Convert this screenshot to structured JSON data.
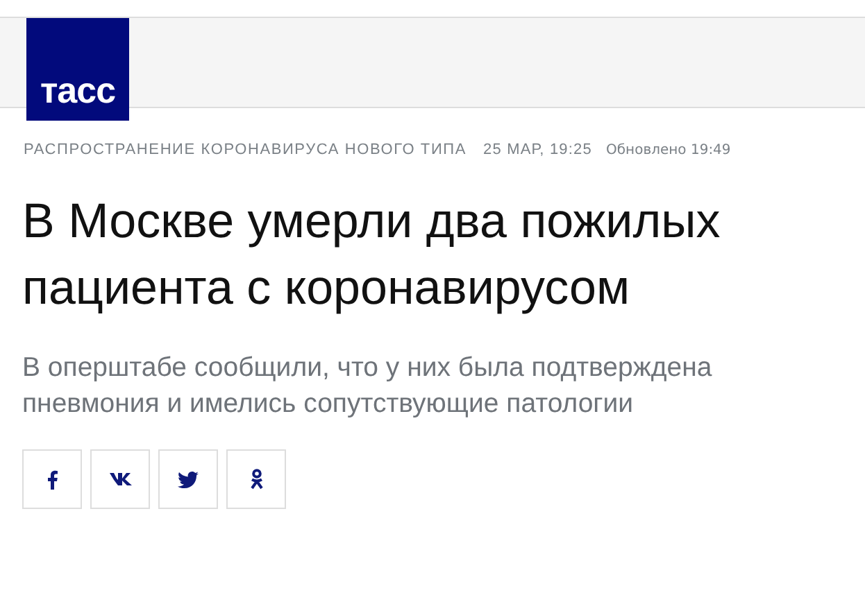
{
  "logo": {
    "text": "тасс"
  },
  "meta": {
    "rubric": "РАСПРОСТРАНЕНИЕ КОРОНАВИРУСА НОВОГО ТИПА",
    "date": "25 МАР, 19:25",
    "updated": "Обновлено 19:49"
  },
  "headline": "В Москве умерли два пожилых пациента с коронавирусом",
  "lead": "В оперштабе сообщили, что у них была подтверждена пневмония и имелись сопутствующие патологии",
  "share_buttons": [
    {
      "kind": "facebook"
    },
    {
      "kind": "vk"
    },
    {
      "kind": "twitter"
    },
    {
      "kind": "ok"
    }
  ]
}
